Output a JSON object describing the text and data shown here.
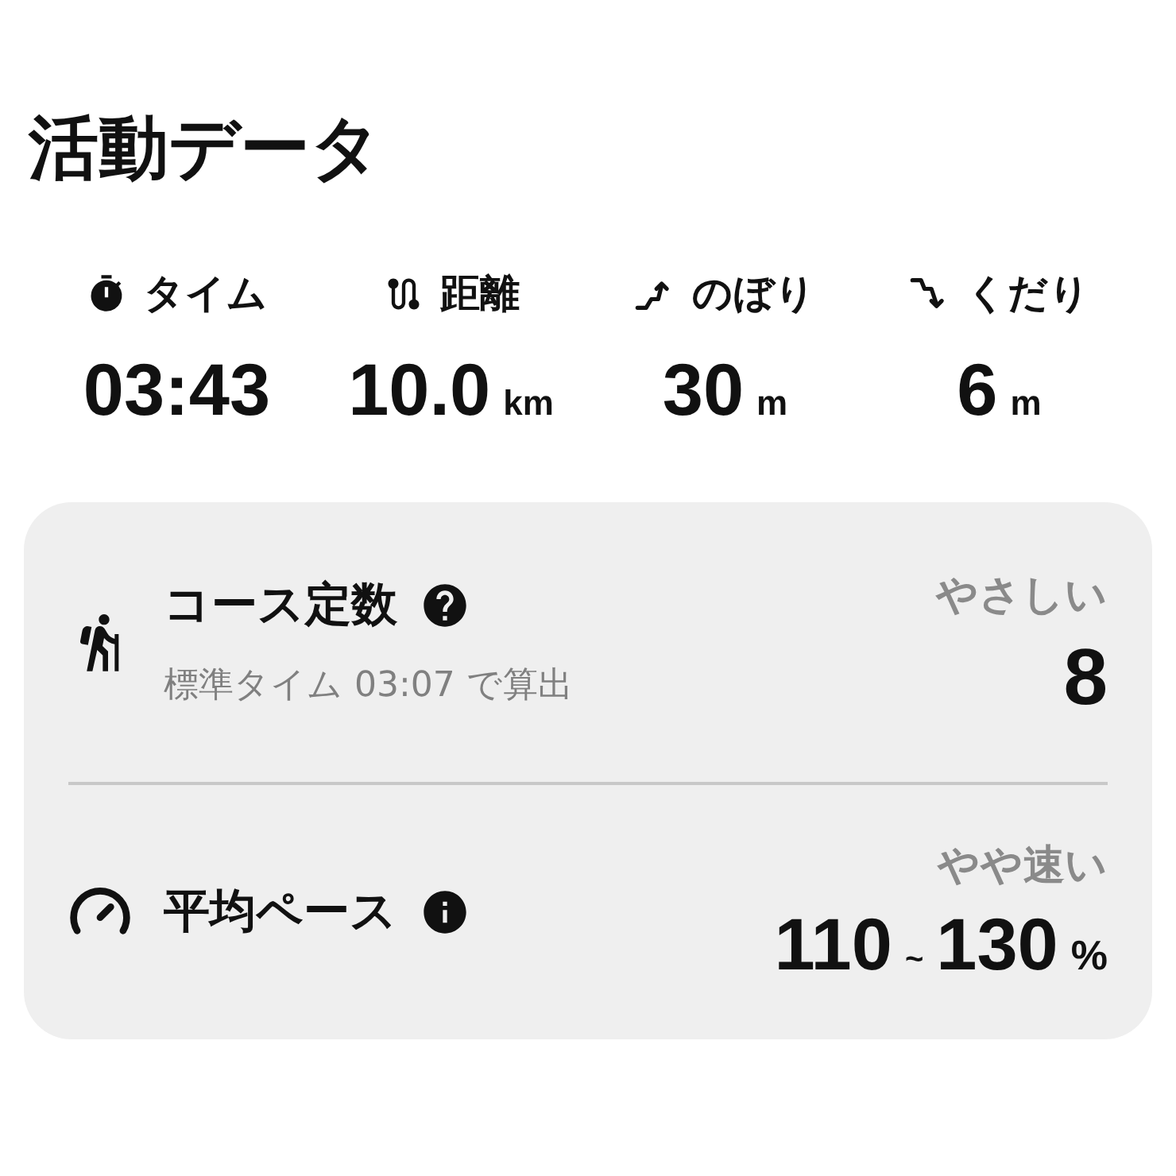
{
  "title": "活動データ",
  "stats": [
    {
      "kind": "time",
      "label": "タイム",
      "value": "03:43"
    },
    {
      "kind": "distance",
      "label": "距離",
      "value": "10.0",
      "unit": "km"
    },
    {
      "kind": "ascent",
      "label": "のぼり",
      "value": "30",
      "unit": "m"
    },
    {
      "kind": "descent",
      "label": "くだり",
      "value": "6",
      "unit": "m"
    }
  ],
  "metrics": [
    {
      "kind": "course",
      "title": "コース定数",
      "badge": {
        "kind": "help"
      },
      "subtitle": "標準タイム 03:07 で算出",
      "rating": "やさしい",
      "value": "8"
    },
    {
      "kind": "pace",
      "title": "平均ペース",
      "badge": {
        "kind": "info"
      },
      "rating": "やや速い",
      "value_from": "110",
      "separator": "~",
      "value_to": "130",
      "unit": "%"
    }
  ]
}
